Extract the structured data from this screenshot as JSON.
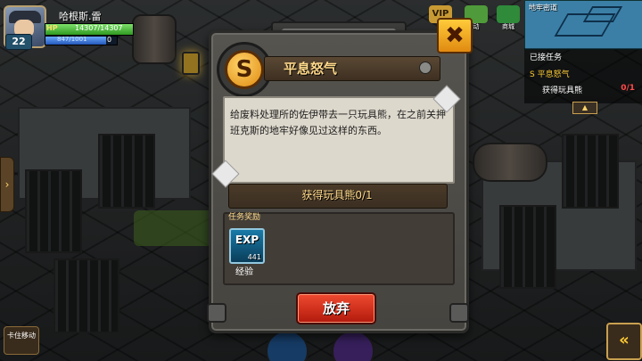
{
  "player": {
    "name": "哈根斯.雷",
    "level": "22",
    "hp_label": "HP",
    "hp_text": "14307/14307",
    "hp_fraction": 1.0,
    "exp_text": "847/1001",
    "exp_fraction": 0.846,
    "currency": "0"
  },
  "top_menu": [
    {
      "icon": "vip-icon",
      "label": "VIP",
      "caption": "福"
    },
    {
      "icon": "event-icon",
      "label": "",
      "caption": "动"
    },
    {
      "icon": "shop-icon",
      "label": "",
      "caption": "商城"
    }
  ],
  "minimap": {
    "location": "地牢密道"
  },
  "tracker": {
    "header": "已接任务",
    "quest_name": "平息怒气",
    "objective": "获得玩具熊",
    "progress": "0/1"
  },
  "dialog": {
    "icon_letter": "S",
    "title": "平息怒气",
    "description": "给废料处理所的佐伊带去一只玩具熊，在之前关押班克斯的地牢好像见过这样的东西。",
    "objective": "获得玩具熊0/1",
    "reward_label": "任务奖励",
    "reward_tag": "EXP",
    "reward_amount": "441",
    "reward_name": "经验",
    "abandon_label": "放弃",
    "close_symbol": "✖"
  },
  "controls": {
    "stuck_label": "卡住移动",
    "side_arrow": "›",
    "next_arrow": "«"
  },
  "colors": {
    "accent_gold": "#ffd98a",
    "abandon_red": "#d83420",
    "progress_red": "#ff4a4a"
  }
}
